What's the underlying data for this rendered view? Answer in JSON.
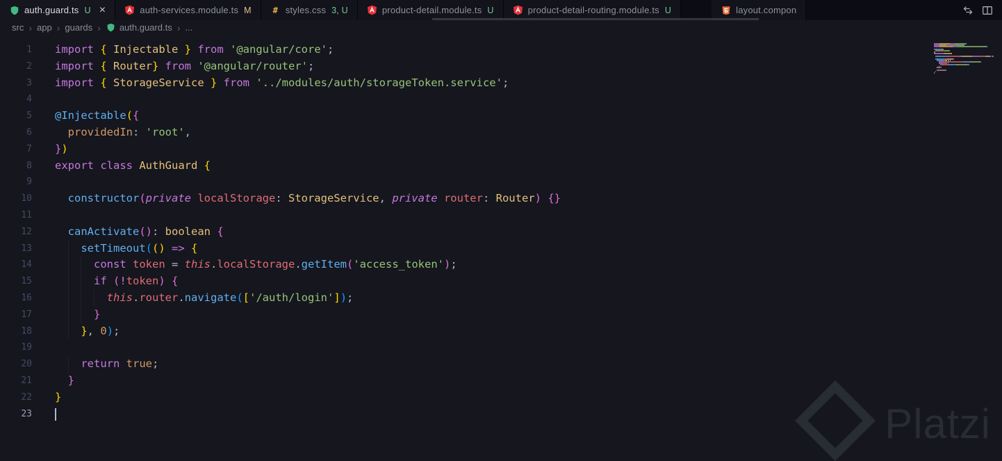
{
  "theme": {
    "editor_bg": "#15161e",
    "tabbar_bg": "#0c0d14",
    "tab_inactive_bg": "#12131b",
    "untracked_color": "#73c991",
    "modified_color": "#e2c08d",
    "syntax_colors": {
      "keyword": "#c678dd",
      "string": "#98c379",
      "type": "#e5c07b",
      "function": "#61afef",
      "variable": "#e06c75",
      "property": "#d19a66",
      "number": "#d19a66",
      "bracket1": "#ffd700",
      "bracket2": "#da70d6",
      "bracket3": "#179fff"
    }
  },
  "tabbar": {
    "tabs": [
      {
        "label": "auth.guard.ts",
        "status": "U",
        "status_color": "#73c991",
        "icon": "guard-shield-icon",
        "icon_color": "#42b883",
        "active": true,
        "show_close": true
      },
      {
        "label": "auth-services.module.ts",
        "status": "M",
        "status_color": "#e2c08d",
        "icon": "angular-icon",
        "icon_color": "#e23237",
        "active": false
      },
      {
        "label": "styles.css",
        "status": "3, U",
        "status_color": "#73c991",
        "icon": "css-hash-icon",
        "icon_color": "#e8b04b",
        "active": false
      },
      {
        "label": "product-detail.module.ts",
        "status": "U",
        "status_color": "#73c991",
        "icon": "angular-icon",
        "icon_color": "#e23237",
        "active": false
      },
      {
        "label": "product-detail-routing.module.ts",
        "status": "U",
        "status_color": "#73c991",
        "icon": "angular-icon",
        "icon_color": "#e23237",
        "active": false
      },
      {
        "label": "layout.compon",
        "status": "",
        "status_color": "",
        "icon": "html-icon",
        "icon_color": "#e8703a",
        "active": false,
        "gap_before": true
      }
    ],
    "actions": [
      {
        "name": "open-changes-icon"
      },
      {
        "name": "split-editor-icon"
      }
    ]
  },
  "breadcrumb": {
    "items": [
      "src",
      "app",
      "guards"
    ],
    "file": {
      "label": "auth.guard.ts",
      "icon": "guard-shield-icon"
    },
    "tail": "..."
  },
  "editor": {
    "cursor_line": 23,
    "lines": [
      {
        "num": 1,
        "tokens": [
          [
            "kw",
            "import "
          ],
          [
            "b1",
            "{"
          ],
          [
            "type",
            " Injectable "
          ],
          [
            "b1",
            "}"
          ],
          [
            "kw",
            " from "
          ],
          [
            "str",
            "'@angular/core'"
          ],
          [
            "pun",
            ";"
          ]
        ]
      },
      {
        "num": 2,
        "tokens": [
          [
            "kw",
            "import "
          ],
          [
            "b1",
            "{"
          ],
          [
            "type",
            " Router"
          ],
          [
            "b1",
            "}"
          ],
          [
            "kw",
            " from "
          ],
          [
            "str",
            "'@angular/router'"
          ],
          [
            "pun",
            ";"
          ]
        ]
      },
      {
        "num": 3,
        "tokens": [
          [
            "kw",
            "import "
          ],
          [
            "b1",
            "{"
          ],
          [
            "type",
            " StorageService "
          ],
          [
            "b1",
            "}"
          ],
          [
            "kw",
            " from "
          ],
          [
            "str",
            "'../modules/auth/storageToken.service'"
          ],
          [
            "pun",
            ";"
          ]
        ]
      },
      {
        "num": 4,
        "tokens": []
      },
      {
        "num": 5,
        "tokens": [
          [
            "fn",
            "@Injectable"
          ],
          [
            "b1",
            "("
          ],
          [
            "b2",
            "{"
          ]
        ]
      },
      {
        "num": 6,
        "tokens": [
          [
            "pun",
            "  "
          ],
          [
            "prop",
            "providedIn"
          ],
          [
            "pun",
            ": "
          ],
          [
            "str",
            "'root'"
          ],
          [
            "pun",
            ","
          ]
        ]
      },
      {
        "num": 7,
        "tokens": [
          [
            "b2",
            "}"
          ],
          [
            "b1",
            ")"
          ]
        ]
      },
      {
        "num": 8,
        "tokens": [
          [
            "kw",
            "export "
          ],
          [
            "kw",
            "class "
          ],
          [
            "type",
            "AuthGuard "
          ],
          [
            "b1",
            "{"
          ]
        ]
      },
      {
        "num": 9,
        "tokens": []
      },
      {
        "num": 10,
        "tokens": [
          [
            "pun",
            "  "
          ],
          [
            "fn",
            "constructor"
          ],
          [
            "b2",
            "("
          ],
          [
            "kwi",
            "private "
          ],
          [
            "var",
            "localStorage"
          ],
          [
            "pun",
            ": "
          ],
          [
            "type",
            "StorageService"
          ],
          [
            "pun",
            ", "
          ],
          [
            "kwi",
            "private "
          ],
          [
            "var",
            "router"
          ],
          [
            "pun",
            ": "
          ],
          [
            "type",
            "Router"
          ],
          [
            "b2",
            ")"
          ],
          [
            "pun",
            " "
          ],
          [
            "b2",
            "{}"
          ]
        ]
      },
      {
        "num": 11,
        "tokens": []
      },
      {
        "num": 12,
        "tokens": [
          [
            "pun",
            "  "
          ],
          [
            "fn",
            "canActivate"
          ],
          [
            "b2",
            "()"
          ],
          [
            "pun",
            ": "
          ],
          [
            "type",
            "boolean "
          ],
          [
            "b2",
            "{"
          ]
        ]
      },
      {
        "num": 13,
        "tokens": [
          [
            "pun",
            "    "
          ],
          [
            "fn",
            "setTimeout"
          ],
          [
            "b3",
            "("
          ],
          [
            "b1",
            "()"
          ],
          [
            "pun",
            " "
          ],
          [
            "kw",
            "=>"
          ],
          [
            "pun",
            " "
          ],
          [
            "b1",
            "{"
          ]
        ]
      },
      {
        "num": 14,
        "tokens": [
          [
            "pun",
            "      "
          ],
          [
            "kw",
            "const "
          ],
          [
            "var",
            "token "
          ],
          [
            "pun",
            "= "
          ],
          [
            "this",
            "this"
          ],
          [
            "pun",
            "."
          ],
          [
            "var",
            "localStorage"
          ],
          [
            "pun",
            "."
          ],
          [
            "fn",
            "getItem"
          ],
          [
            "b2",
            "("
          ],
          [
            "str",
            "'access_token'"
          ],
          [
            "b2",
            ")"
          ],
          [
            "pun",
            ";"
          ]
        ]
      },
      {
        "num": 15,
        "tokens": [
          [
            "pun",
            "      "
          ],
          [
            "kw",
            "if "
          ],
          [
            "b2",
            "("
          ],
          [
            "kw",
            "!"
          ],
          [
            "var",
            "token"
          ],
          [
            "b2",
            ")"
          ],
          [
            "pun",
            " "
          ],
          [
            "b2",
            "{"
          ]
        ]
      },
      {
        "num": 16,
        "tokens": [
          [
            "pun",
            "        "
          ],
          [
            "this",
            "this"
          ],
          [
            "pun",
            "."
          ],
          [
            "var",
            "router"
          ],
          [
            "pun",
            "."
          ],
          [
            "fn",
            "navigate"
          ],
          [
            "b3",
            "("
          ],
          [
            "b1",
            "["
          ],
          [
            "str",
            "'/auth/login'"
          ],
          [
            "b1",
            "]"
          ],
          [
            "b3",
            ")"
          ],
          [
            "pun",
            ";"
          ]
        ]
      },
      {
        "num": 17,
        "tokens": [
          [
            "pun",
            "      "
          ],
          [
            "b2",
            "}"
          ]
        ]
      },
      {
        "num": 18,
        "tokens": [
          [
            "pun",
            "    "
          ],
          [
            "b1",
            "}"
          ],
          [
            "pun",
            ", "
          ],
          [
            "num",
            "0"
          ],
          [
            "b3",
            ")"
          ],
          [
            "pun",
            ";"
          ]
        ]
      },
      {
        "num": 19,
        "tokens": []
      },
      {
        "num": 20,
        "tokens": [
          [
            "pun",
            "    "
          ],
          [
            "kw",
            "return "
          ],
          [
            "bool",
            "true"
          ],
          [
            "pun",
            ";"
          ]
        ]
      },
      {
        "num": 21,
        "tokens": [
          [
            "pun",
            "  "
          ],
          [
            "b2",
            "}"
          ]
        ]
      },
      {
        "num": 22,
        "tokens": [
          [
            "b1",
            "}"
          ]
        ]
      },
      {
        "num": 23,
        "tokens": []
      }
    ]
  },
  "watermark": {
    "text": "Platzi",
    "icon": "platzi-diamond-icon"
  }
}
